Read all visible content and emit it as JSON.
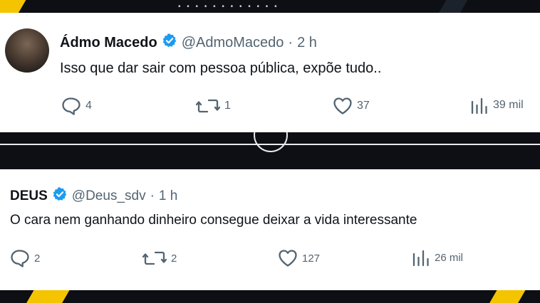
{
  "tweets": [
    {
      "display_name": "Ádmo Macedo",
      "handle": "@AdmoMacedo",
      "separator": "·",
      "time": "2 h",
      "text": "Isso que dar sair com pessoa pública, expõe tudo..",
      "verified": true,
      "replies": "4",
      "retweets": "1",
      "likes": "37",
      "views": "39 mil"
    },
    {
      "display_name": "DEUS",
      "handle": "@Deus_sdv",
      "separator": "·",
      "time": "1 h",
      "text": "O cara nem ganhando dinheiro consegue deixar a vida interessante",
      "verified": true,
      "replies": "2",
      "retweets": "2",
      "likes": "127",
      "views": "26 mil"
    }
  ],
  "colors": {
    "verified_badge": "#1d9bf0",
    "secondary_text": "#536471",
    "primary_text": "#0f1419",
    "background_accent": "#f5c400"
  },
  "icons": [
    "reply-icon",
    "retweet-icon",
    "like-icon",
    "views-icon",
    "verified-badge-icon"
  ]
}
